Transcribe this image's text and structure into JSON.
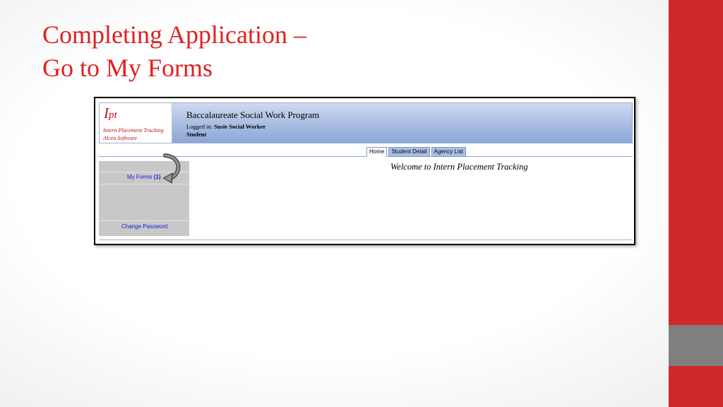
{
  "slide": {
    "title_line1": "Completing Application –",
    "title_line2": "Go to My Forms"
  },
  "app": {
    "logo_main": "I",
    "logo_suffix": "pt",
    "logo_line1": "Intern Placement Tracking",
    "logo_line2": "Alcea Software",
    "program_title": "Baccalaureate Social Work Program",
    "logged_in_label": "Logged in:",
    "logged_in_user": "Susie Social Worker",
    "role": "Student",
    "tabs": [
      "Home",
      "Student Detail",
      "Agency List"
    ],
    "active_tab": "Home",
    "welcome": "Welcome to Intern Placement Tracking",
    "sidebar": {
      "my_forms_label": "My Forms",
      "my_forms_count": "(1)",
      "change_password": "Change Password"
    }
  },
  "colors": {
    "accent_red": "#d0272a",
    "title_red": "#e0201f",
    "header_blue": "#8ba6d6",
    "link_blue": "#1a1adb"
  },
  "icons": [
    "curved-arrow-icon"
  ]
}
